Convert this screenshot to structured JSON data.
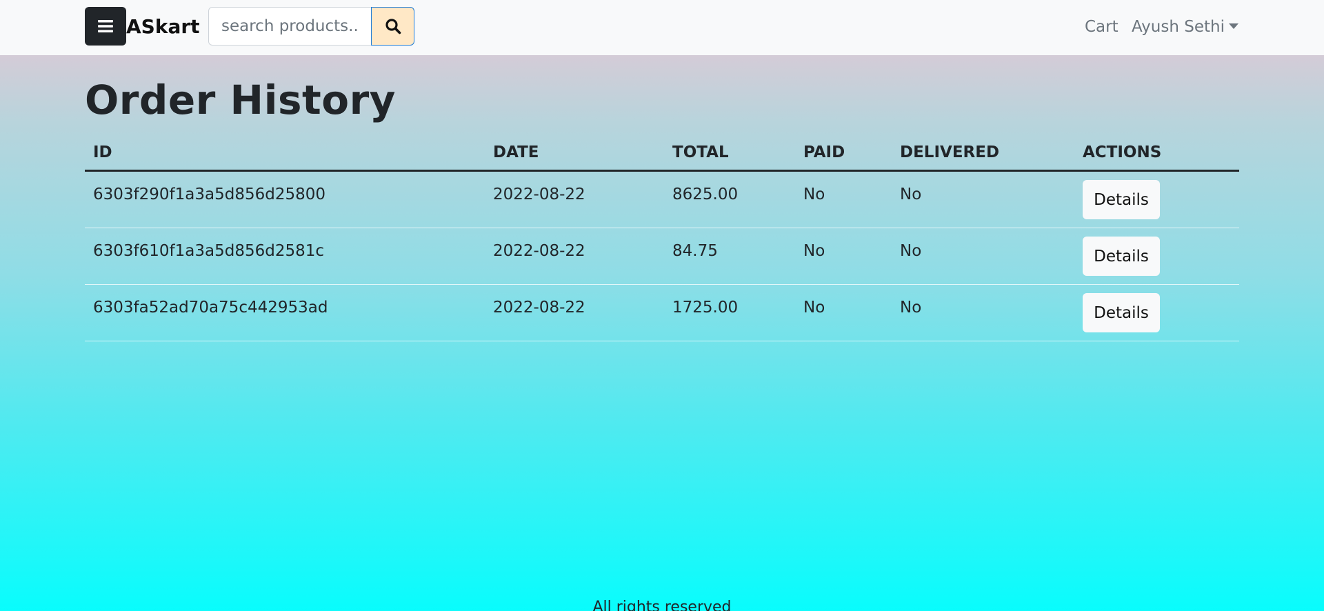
{
  "navbar": {
    "brand": "ASkart",
    "search_placeholder": "search products...",
    "menu_icon": "hamburger-icon",
    "search_icon": "search-icon",
    "cart_label": "Cart",
    "user_label": "Ayush Sethi"
  },
  "page": {
    "title": "Order History"
  },
  "table": {
    "headers": [
      "ID",
      "DATE",
      "TOTAL",
      "PAID",
      "DELIVERED",
      "ACTIONS"
    ],
    "rows": [
      {
        "id": "6303f290f1a3a5d856d25800",
        "date": "2022-08-22",
        "total": "8625.00",
        "paid": "No",
        "delivered": "No",
        "action": "Details"
      },
      {
        "id": "6303f610f1a3a5d856d2581c",
        "date": "2022-08-22",
        "total": "84.75",
        "paid": "No",
        "delivered": "No",
        "action": "Details"
      },
      {
        "id": "6303fa52ad70a75c442953ad",
        "date": "2022-08-22",
        "total": "1725.00",
        "paid": "No",
        "delivered": "No",
        "action": "Details"
      }
    ]
  },
  "footer": {
    "text": "All rights reserved"
  },
  "colors": {
    "navbar_bg": "#f8f9fa",
    "menu_btn_bg": "#212529",
    "search_btn_bg": "#ffe8c6",
    "search_btn_border": "#1d7bd6",
    "gradient_top": "#ebc5d3",
    "gradient_bottom": "#08fdfd"
  }
}
